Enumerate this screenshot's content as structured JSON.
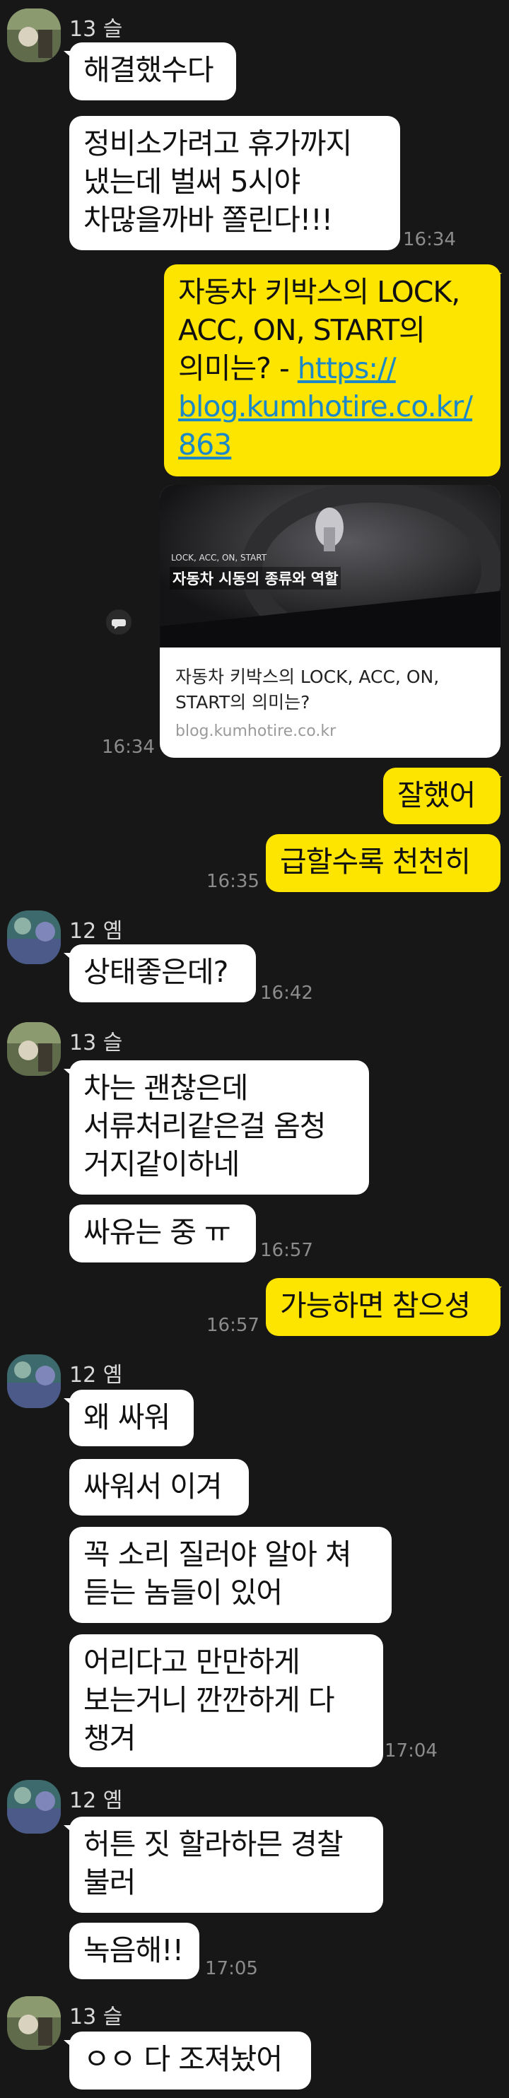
{
  "senders": {
    "s13": "13 슬",
    "s12": "12 옘"
  },
  "messages": {
    "m1": "해결했수다",
    "m2": "정비소가려고 휴가까지\n냈는데 벌써 5시야\n차많을까바 쫄린다!!!",
    "m3_text": "자동차 키박스의 LOCK,\nACC, ON, START의\n의미는? - ",
    "m3_link": "https://\nblog.kumhotire.co.kr/\n863",
    "m4": "잘했어",
    "m5": "급할수록 천천히",
    "m6": "상태좋은데?",
    "m7": "차는 괜찮은데\n서류처리같은걸 옴청\n거지같이하네",
    "m8": "싸유는 중 ㅠ",
    "m9": "가능하면 참으셩",
    "m10": "왜 싸워",
    "m11": "싸워서 이겨",
    "m12": "꼭 소리 질러야 알아 쳐\n듣는 놈들이 있어",
    "m13": "어리다고 만만하게\n보는거니 깐깐하게 다\n챙겨",
    "m14": "허튼 짓 할라하믄 경찰\n불러",
    "m15": "녹음해!!",
    "m16": "ㅇㅇ 다 조져놨어"
  },
  "times": {
    "t1": "16:34",
    "t2": "16:34",
    "t3": "16:35",
    "t4": "16:42",
    "t5": "16:57",
    "t6": "16:57",
    "t7": "17:04",
    "t8": "17:05"
  },
  "link_card": {
    "image_tag_small": "LOCK, ACC, ON, START",
    "image_tag_big": "자동차 시동의 종류와 역할",
    "title": "자동차 키박스의 LOCK, ACC, ON,\nSTART의 의미는?",
    "domain": "blog.kumhotire.co.kr"
  },
  "icons": {
    "share": "share-icon",
    "avatar": "profile-avatar"
  },
  "colors": {
    "background": "#171717",
    "incoming": "#ffffff",
    "outgoing": "#fee500",
    "link": "#1c88c7"
  }
}
